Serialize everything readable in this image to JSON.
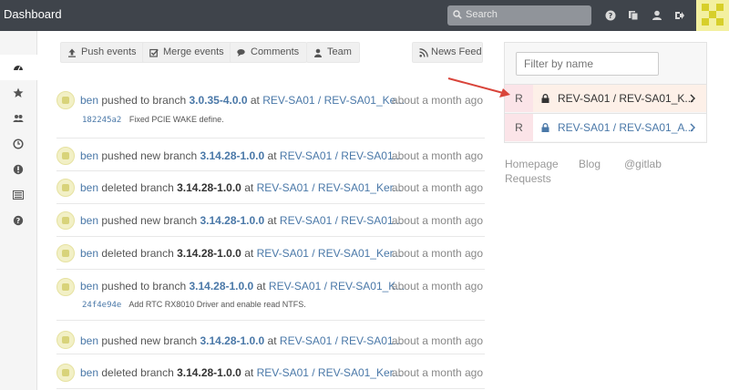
{
  "header": {
    "title": "Dashboard",
    "search_placeholder": "Search"
  },
  "sidebar": {
    "items": [
      "dashboard-icon",
      "star-icon",
      "users-icon",
      "clock-icon",
      "exclamation-icon",
      "list-icon",
      "question-icon"
    ]
  },
  "tabs": [
    {
      "label": "Push events",
      "icon": "upload-icon"
    },
    {
      "label": "Merge events",
      "icon": "checkbox-icon"
    },
    {
      "label": "Comments",
      "icon": "comments-icon"
    },
    {
      "label": "Team",
      "icon": "user-icon"
    }
  ],
  "news_feed": {
    "label": "News Feed",
    "icon": "rss-icon"
  },
  "feed": [
    {
      "user": "ben",
      "action": "pushed to branch",
      "branch": "3.0.35-4.0.0",
      "at": "at",
      "project": "REV-SA01 / REV-SA01_Ke...",
      "time": "about a month ago",
      "sha": "182245a2",
      "message": "Fixed PCIE WAKE define."
    },
    {
      "user": "ben",
      "action": "pushed new branch",
      "branch": "3.14.28-1.0.0",
      "at": "at",
      "project": "REV-SA01 / REV-SA01...",
      "time": "about a month ago"
    },
    {
      "user": "ben",
      "action": "deleted branch",
      "branch": "3.14.28-1.0.0",
      "at": "at",
      "project": "REV-SA01 / REV-SA01_Ker...",
      "time": "about a month ago"
    },
    {
      "user": "ben",
      "action": "pushed new branch",
      "branch": "3.14.28-1.0.0",
      "at": "at",
      "project": "REV-SA01 / REV-SA01...",
      "time": "about a month ago"
    },
    {
      "user": "ben",
      "action": "deleted branch",
      "branch": "3.14.28-1.0.0",
      "at": "at",
      "project": "REV-SA01 / REV-SA01_Ker...",
      "time": "about a month ago"
    },
    {
      "user": "ben",
      "action": "pushed to branch",
      "branch": "3.14.28-1.0.0",
      "at": "at",
      "project": "REV-SA01 / REV-SA01_K...",
      "time": "about a month ago",
      "sha": "24f4e94e",
      "message": "Add RTC RX8010 Driver and enable read NTFS."
    },
    {
      "user": "ben",
      "action": "pushed new branch",
      "branch": "3.14.28-1.0.0",
      "at": "at",
      "project": "REV-SA01 / REV-SA01...",
      "time": "about a month ago"
    },
    {
      "user": "ben",
      "action": "deleted branch",
      "branch": "3.14.28-1.0.0",
      "at": "at",
      "project": "REV-SA01 / REV-SA01_Ker...",
      "time": "about a month ago"
    }
  ],
  "projects_panel": {
    "filter_placeholder": "Filter by name",
    "projects": [
      {
        "letter": "R",
        "name": "REV-SA01 / REV-SA01_K..."
      },
      {
        "letter": "R",
        "name": "REV-SA01 / REV-SA01_A..."
      }
    ]
  },
  "footer_links": {
    "homepage": "Homepage",
    "blog": "Blog",
    "gitlab": "@gitlab",
    "requests": "Requests"
  },
  "colors": {
    "topbar": "#3f444b",
    "link": "#4a78a8",
    "highlight_row": "#fdf0e8",
    "annotation_arrow": "#d9443a"
  }
}
